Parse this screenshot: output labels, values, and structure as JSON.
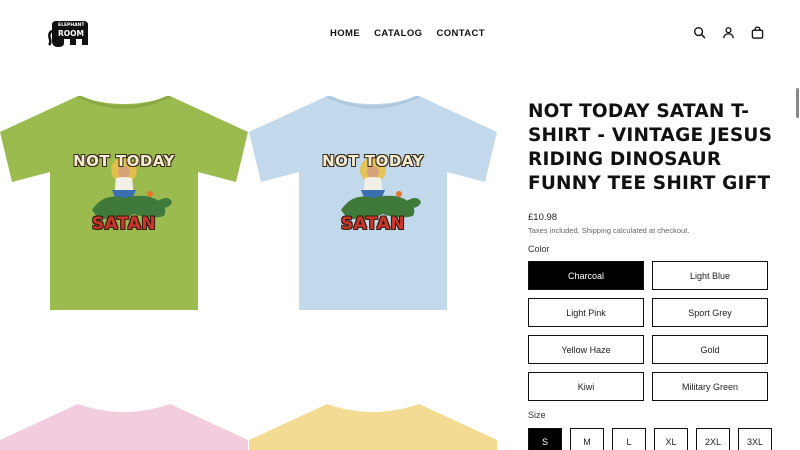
{
  "brand": {
    "line1": "ELEPHANT",
    "line2": "ROOM"
  },
  "nav": [
    {
      "label": "HOME"
    },
    {
      "label": "CATALOG"
    },
    {
      "label": "CONTACT"
    }
  ],
  "header_icons": [
    "search-icon",
    "account-icon",
    "cart-icon"
  ],
  "gallery": {
    "print_top_text": "NOT TODAY",
    "print_bottom_text": "SATAN",
    "shirt_colors": {
      "green": "#9bbb4f",
      "blue": "#c2d9ec",
      "pink": "#f3cddd",
      "yellow": "#f3db93"
    }
  },
  "product": {
    "title": "NOT TODAY SATAN T-SHIRT - VINTAGE JESUS RIDING DINOSAUR FUNNY TEE SHIRT GIFT",
    "price": "£10.98",
    "tax_note": "Taxes included. Shipping calculated at checkout.",
    "color_label": "Color",
    "colors": [
      "Charcoal",
      "Light Blue",
      "Light Pink",
      "Sport Grey",
      "Yellow Haze",
      "Gold",
      "Kiwi",
      "Military Green"
    ],
    "selected_color": "Charcoal",
    "size_label": "Size",
    "sizes": [
      "S",
      "M",
      "L",
      "XL",
      "2XL",
      "3XL"
    ],
    "selected_size": "S"
  }
}
